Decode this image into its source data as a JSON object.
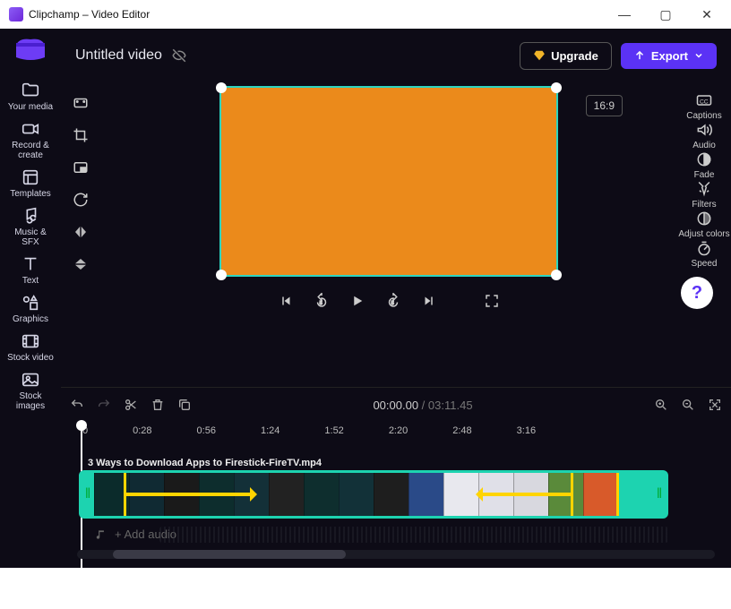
{
  "window": {
    "title": "Clipchamp – Video Editor"
  },
  "project": {
    "title": "Untitled video"
  },
  "buttons": {
    "upgrade": "Upgrade",
    "export": "Export"
  },
  "aspect": "16:9",
  "nav_left": [
    {
      "id": "your-media",
      "label": "Your media"
    },
    {
      "id": "record",
      "label": "Record & create"
    },
    {
      "id": "templates",
      "label": "Templates"
    },
    {
      "id": "music",
      "label": "Music & SFX"
    },
    {
      "id": "text",
      "label": "Text"
    },
    {
      "id": "graphics",
      "label": "Graphics"
    },
    {
      "id": "stock-video",
      "label": "Stock video"
    },
    {
      "id": "stock-images",
      "label": "Stock images"
    }
  ],
  "nav_right": [
    {
      "id": "captions",
      "label": "Captions"
    },
    {
      "id": "audio",
      "label": "Audio"
    },
    {
      "id": "fade",
      "label": "Fade"
    },
    {
      "id": "filters",
      "label": "Filters"
    },
    {
      "id": "adjust",
      "label": "Adjust colors"
    },
    {
      "id": "speed",
      "label": "Speed"
    }
  ],
  "timecode": {
    "current": "00:00.00",
    "sep": " / ",
    "duration": "03:11.45"
  },
  "ruler": [
    "0",
    "0:28",
    "0:56",
    "1:24",
    "1:52",
    "2:20",
    "2:48",
    "3:16"
  ],
  "clip": {
    "name": "3 Ways to Download Apps to Firestick-FireTV.mp4"
  },
  "add_audio": "+ Add audio",
  "thumb_colors": [
    "#0b2b2b",
    "#102a33",
    "#1a1a1a",
    "#0d2d2d",
    "#133038",
    "#222",
    "#0e2e2e",
    "#123138",
    "#1e1e1e",
    "#2a4a88",
    "#e8e8ee",
    "#e0e0e8",
    "#d8d8df",
    "#5a8a3a",
    "#d85a2a",
    "#1dd3b0"
  ]
}
